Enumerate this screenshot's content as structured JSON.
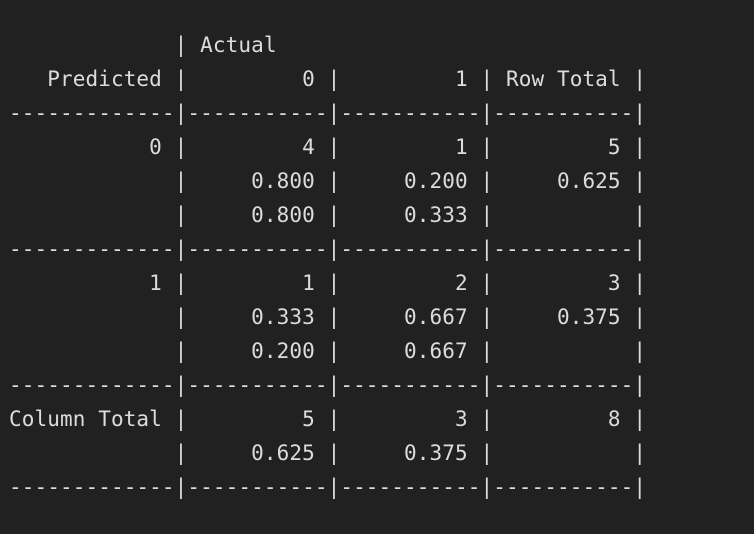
{
  "terminal": {
    "lines": [
      "             | Actual",
      "   Predicted |         0 |         1 | Row Total |",
      "-------------|-----------|-----------|-----------|",
      "           0 |         4 |         1 |         5 |",
      "             |     0.800 |     0.200 |     0.625 |",
      "             |     0.800 |     0.333 |           |",
      "-------------|-----------|-----------|-----------|",
      "           1 |         1 |         2 |         3 |",
      "             |     0.333 |     0.667 |     0.375 |",
      "             |     0.200 |     0.667 |           |",
      "-------------|-----------|-----------|-----------|",
      "Column Total |         5 |         3 |         8 |",
      "             |     0.625 |     0.375 |           |",
      "-------------|-----------|-----------|-----------|"
    ]
  },
  "colors": {
    "background": "#212121",
    "text": "#dcdcdc"
  }
}
